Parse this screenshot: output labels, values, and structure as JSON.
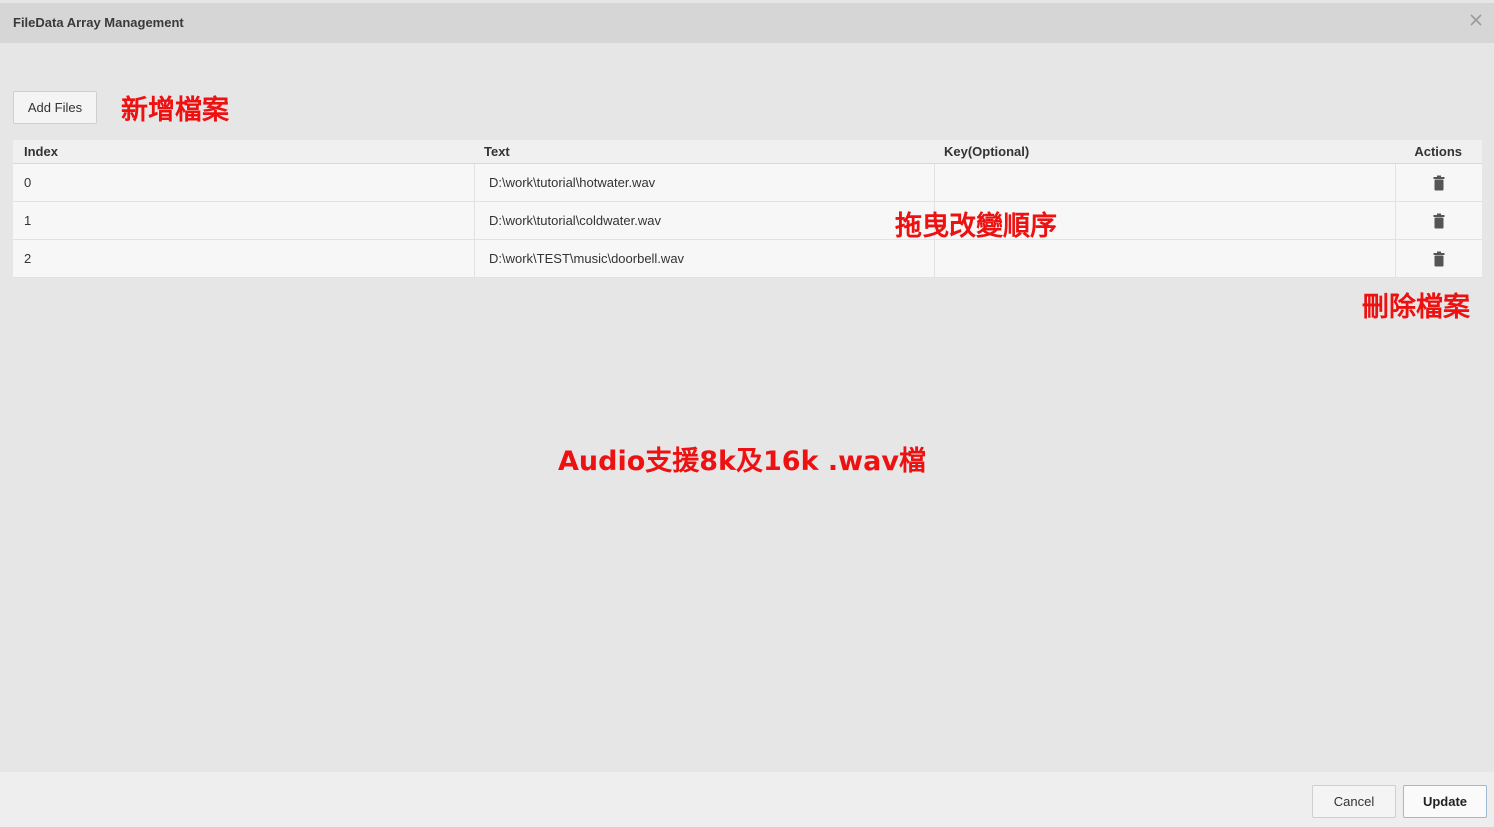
{
  "dialog": {
    "title": "FileData Array Management",
    "close_icon": "close-icon"
  },
  "toolbar": {
    "add_files_label": "Add Files"
  },
  "annotations": {
    "add_file": "新增檔案",
    "drag_reorder": "拖曳改變順序",
    "delete_file": "刪除檔案",
    "audio_support": "Audio支援8k及16k .wav檔",
    "color": "#ee1111"
  },
  "table": {
    "columns": {
      "index": "Index",
      "text": "Text",
      "key": "Key(Optional)",
      "actions": "Actions"
    },
    "rows": [
      {
        "index": "0",
        "text": "D:\\work\\tutorial\\hotwater.wav",
        "key": "",
        "action_icon": "trash-icon"
      },
      {
        "index": "1",
        "text": "D:\\work\\tutorial\\coldwater.wav",
        "key": "",
        "action_icon": "trash-icon"
      },
      {
        "index": "2",
        "text": "D:\\work\\TEST\\music\\doorbell.wav",
        "key": "",
        "action_icon": "trash-icon"
      }
    ]
  },
  "footer": {
    "cancel_label": "Cancel",
    "update_label": "Update"
  }
}
